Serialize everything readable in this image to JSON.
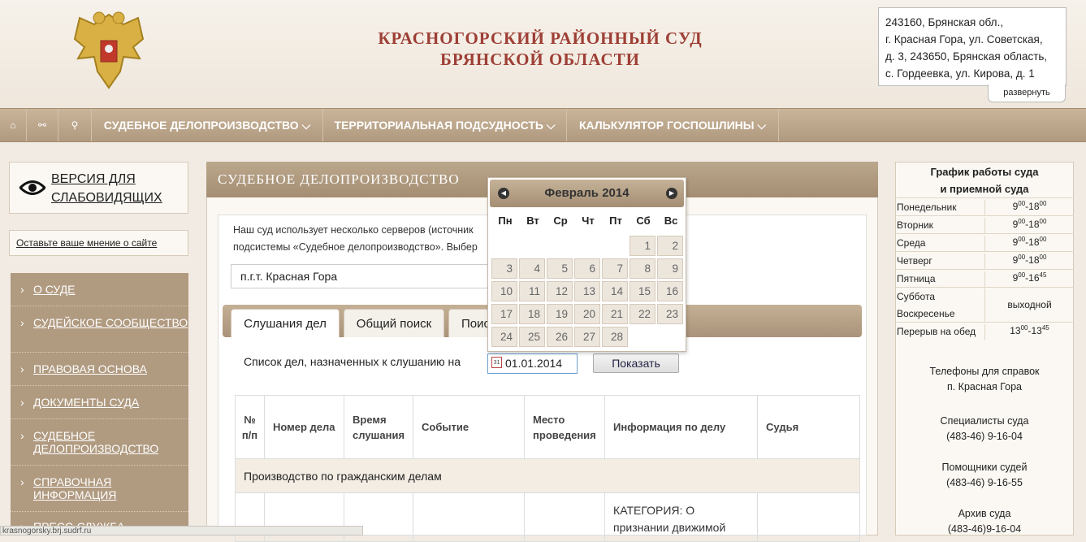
{
  "header": {
    "title_line1": "КРАСНОГОРСКИЙ РАЙОННЫЙ СУД",
    "title_line2": "БРЯНСКОЙ ОБЛАСТИ",
    "address_lines": [
      "243160, Брянская обл.,",
      "г. Красная Гора, ул. Советская,",
      "д. 3, 243650, Брянская область,",
      "с. Гордеевка, ул. Кирова, д. 1"
    ],
    "expand_label": "развернуть"
  },
  "nav": {
    "home_icon": "⌂",
    "sitemap_icon": "⚯",
    "search_icon": "⚲",
    "items": [
      "СУДЕБНОЕ ДЕЛОПРОИЗВОДСТВО ⌵",
      "ТЕРРИТОРИАЛЬНАЯ ПОДСУДНОСТЬ ⌵",
      "КАЛЬКУЛЯТОР ГОСПОШЛИНЫ ⌵"
    ]
  },
  "sidebar": {
    "vision_line1": "ВЕРСИЯ ДЛЯ",
    "vision_line2": "СЛАБОВИДЯЩИХ",
    "opinion": "Оставьте ваше мнение о сайте",
    "menu": [
      "О СУДЕ",
      "СУДЕЙСКОЕ СООБЩЕСТВО",
      "ПРАВОВАЯ ОСНОВА",
      "ДОКУМЕНТЫ СУДА",
      "СУДЕБНОЕ ДЕЛОПРОИЗВОДСТВО",
      "СПРАВОЧНАЯ ИНФОРМАЦИЯ",
      "ПРЕСС-СЛУЖБА"
    ],
    "arrow": "›"
  },
  "main": {
    "heading": "СУДЕБНОЕ ДЕЛОПРОИЗВОДСТВО",
    "intro_line1": "Наш суд использует несколько серверов (источник",
    "intro_line2": "подсистемы «Судебное делопроизводство». Выбер",
    "server_select": "п.г.т. Красная Гора",
    "tabs": [
      "Слушания дел",
      "Общий поиск",
      "Поис"
    ],
    "list_label": "Список дел, назначенных к слушанию на",
    "date_value": "01.01.2014",
    "calendar_icon_text": "31",
    "show_button": "Показать",
    "table": {
      "headers": [
        "№ п/п",
        "Номер дела",
        "Время слушания",
        "Событие",
        "Место проведения",
        "Информация по делу",
        "Судья"
      ],
      "group_row": "Производство по гражданским делам",
      "info_line1": "КАТЕГОРИЯ: О",
      "info_line2": "признании движимой"
    }
  },
  "calendar": {
    "title": "Февраль 2014",
    "prev_icon": "◀",
    "next_icon": "▶",
    "weekdays": [
      "Пн",
      "Вт",
      "Ср",
      "Чт",
      "Пт",
      "Сб",
      "Вс"
    ],
    "days": [
      "1",
      "2",
      "3",
      "4",
      "5",
      "6",
      "7",
      "8",
      "9",
      "10",
      "11",
      "12",
      "13",
      "14",
      "15",
      "16",
      "17",
      "18",
      "19",
      "20",
      "21",
      "22",
      "23",
      "24",
      "25",
      "26",
      "27",
      "28"
    ]
  },
  "schedule": {
    "title_line1": "График работы суда",
    "title_line2": "и приемной суда",
    "rows": [
      {
        "day": "Понедельник",
        "from": "9",
        "fsup": "00",
        "to": "18",
        "tsup": "00"
      },
      {
        "day": "Вторник",
        "from": "9",
        "fsup": "00",
        "to": "18",
        "tsup": "00"
      },
      {
        "day": "Среда",
        "from": "9",
        "fsup": "00",
        "to": "18",
        "tsup": "00"
      },
      {
        "day": "Четверг",
        "from": "9",
        "fsup": "00",
        "to": "18",
        "tsup": "00"
      },
      {
        "day": "Пятница",
        "from": "9",
        "fsup": "00",
        "to": "16",
        "tsup": "45"
      }
    ],
    "weekend_sat": "Суббота",
    "weekend_sun": "Воскресенье",
    "weekend_value": "выходной",
    "lunch_label": "Перерыв на обед",
    "lunch_from": "13",
    "lunch_fsup": "00",
    "lunch_to": "13",
    "lunch_tsup": "45",
    "phones_title1": "Телефоны для справок",
    "phones_title2": "п. Красная Гора",
    "phones": [
      {
        "label": "Специалисты суда",
        "number": "(483-46) 9-16-04"
      },
      {
        "label": "Помощники судей",
        "number": "(483-46) 9-16-55"
      },
      {
        "label": "Архив суда",
        "number": "(483-46)9-16-04"
      }
    ]
  },
  "status_bar": "krasnogorsky.brj.sudrf.ru"
}
